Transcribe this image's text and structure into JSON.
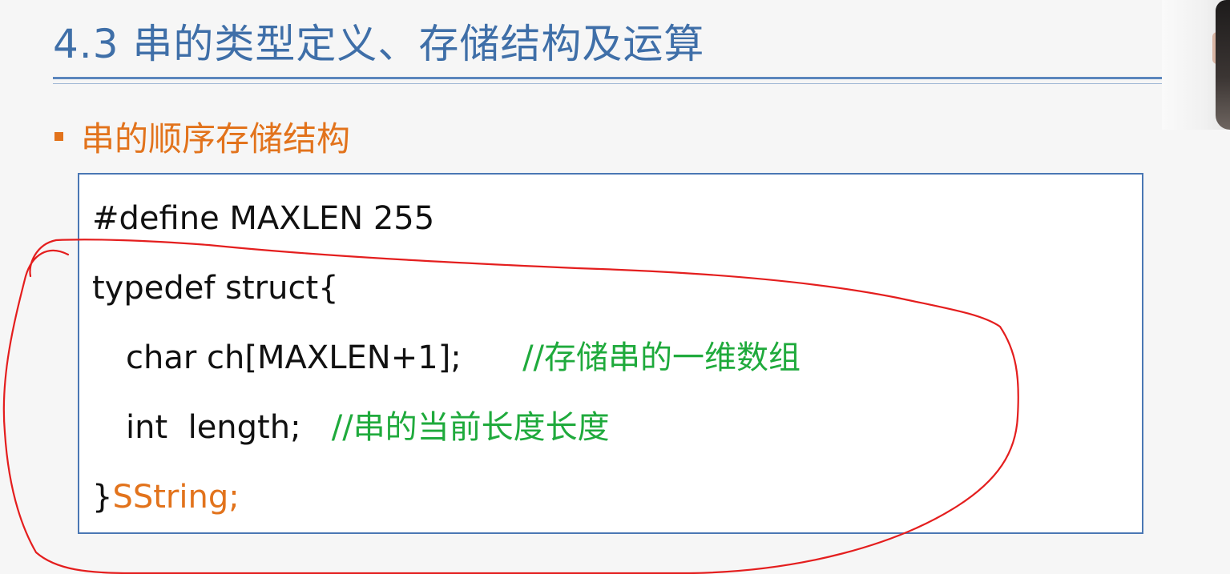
{
  "slide": {
    "title": "4.3 串的类型定义、存储结构及运算",
    "bullet": "串的顺序存储结构"
  },
  "code": {
    "line1": "#define MAXLEN 255",
    "line2": "typedef struct{",
    "line3_code": "char ch[MAXLEN+1];",
    "line3_comment": "//存储串的一维数组",
    "line4_code": "int  length;",
    "line4_comment": "//串的当前长度长度",
    "line5_brace": "}",
    "line5_type": "SString;"
  },
  "colors": {
    "title": "#3f6fa8",
    "bullet": "#e2731c",
    "comment": "#1faa3c",
    "box_border": "#4a77b4",
    "annotation": "#e41e1e"
  }
}
